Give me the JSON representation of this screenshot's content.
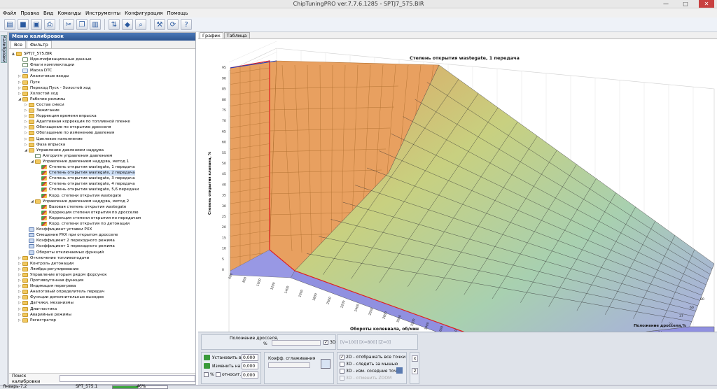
{
  "window": {
    "title": "ChipTuningPRO ver.7.7.6.1285 - SPTJ7_575.BIR",
    "minimize": "—",
    "maximize": "□",
    "close": "✕"
  },
  "menu": [
    "Файл",
    "Правка",
    "Вид",
    "Команды",
    "Инструменты",
    "Конфигурация",
    "Помощь"
  ],
  "sidetab": {
    "label": "Калибровки"
  },
  "leftpanel": {
    "header": "Меню калибровок",
    "tabs": [
      "Все",
      "Фильтр"
    ],
    "search_label": "Поиск калибровки",
    "search_value": ""
  },
  "tree": [
    {
      "label": "SPTJ7_575.BIR",
      "level": 0,
      "icon": "folder",
      "tw": "▲"
    },
    {
      "label": "Идентификационные данные",
      "level": 1,
      "icon": "check",
      "tw": ""
    },
    {
      "label": "Флаги комплектации",
      "level": 1,
      "icon": "check",
      "tw": ""
    },
    {
      "label": "Маска DTC",
      "level": 1,
      "icon": "doc",
      "tw": ""
    },
    {
      "label": "Аналоговые входы",
      "level": 1,
      "icon": "folder",
      "tw": "▷"
    },
    {
      "label": "Пуск",
      "level": 1,
      "icon": "folder",
      "tw": "▷"
    },
    {
      "label": "Переход Пуск - Холостой ход",
      "level": 1,
      "icon": "folder",
      "tw": "▷"
    },
    {
      "label": "Холостой ход",
      "level": 1,
      "icon": "folder",
      "tw": "▷"
    },
    {
      "label": "Рабочие режимы",
      "level": 1,
      "icon": "folder",
      "tw": "◢"
    },
    {
      "label": "Состав смеси",
      "level": 2,
      "icon": "folder",
      "tw": "▷"
    },
    {
      "label": "Зажигание",
      "level": 2,
      "icon": "folder",
      "tw": "▷"
    },
    {
      "label": "Коррекция времени впрыска",
      "level": 2,
      "icon": "folder",
      "tw": "▷"
    },
    {
      "label": "Адаптивная коррекция по топливной пленке",
      "level": 2,
      "icon": "folder",
      "tw": "▷"
    },
    {
      "label": "Обогащение по открытию дросселя",
      "level": 2,
      "icon": "folder",
      "tw": "▷"
    },
    {
      "label": "Обогащение по изменению давления",
      "level": 2,
      "icon": "folder",
      "tw": "▷"
    },
    {
      "label": "Цикловое наполнение",
      "level": 2,
      "icon": "folder",
      "tw": "▷"
    },
    {
      "label": "Фаза впрыска",
      "level": 2,
      "icon": "folder",
      "tw": "▷"
    },
    {
      "label": "Управление давлением наддува",
      "level": 2,
      "icon": "folder",
      "tw": "◢"
    },
    {
      "label": "Алгоритм управления давлением",
      "level": 3,
      "icon": "check",
      "tw": ""
    },
    {
      "label": "Управление давлением наддува, метод 1",
      "level": 3,
      "icon": "folder",
      "tw": "◢"
    },
    {
      "label": "Степень открытия wastegate, 1 передача",
      "level": 4,
      "icon": "chart",
      "tw": ""
    },
    {
      "label": "Степень открытия wastegate, 2 передача",
      "level": 4,
      "icon": "chart",
      "tw": ""
    },
    {
      "label": "Степень открытия wastegate, 3 передача",
      "level": 4,
      "icon": "chart",
      "tw": ""
    },
    {
      "label": "Степень открытия wastegate, 4 передача",
      "level": 4,
      "icon": "chart",
      "tw": ""
    },
    {
      "label": "Степень открытия wastegate, 5,6 передачи",
      "level": 4,
      "icon": "chart",
      "tw": ""
    },
    {
      "label": "Корр. степени открытия wastegate",
      "level": 4,
      "icon": "chart",
      "tw": ""
    },
    {
      "label": "Управление давлением наддува, метод 2",
      "level": 3,
      "icon": "folder",
      "tw": "◢"
    },
    {
      "label": "Базовая степень открытия wastegate",
      "level": 4,
      "icon": "chart",
      "tw": ""
    },
    {
      "label": "Коррекция степени открытия по дросселю",
      "level": 4,
      "icon": "chart",
      "tw": ""
    },
    {
      "label": "Коррекция степени открытия по передачам",
      "level": 4,
      "icon": "chart",
      "tw": ""
    },
    {
      "label": "Корр. степени открытия по детонации",
      "level": 4,
      "icon": "chart",
      "tw": ""
    },
    {
      "label": "Коэффициент уставки РХХ",
      "level": 2,
      "icon": "grid",
      "tw": ""
    },
    {
      "label": "Смещение РХХ при открытом дросселе",
      "level": 2,
      "icon": "grid",
      "tw": ""
    },
    {
      "label": "Коэффициент 2 переходного режима",
      "level": 2,
      "icon": "grid",
      "tw": ""
    },
    {
      "label": "Коэффициент 1 переходного режима",
      "level": 2,
      "icon": "grid",
      "tw": ""
    },
    {
      "label": "Обороты отключаемых функций",
      "level": 2,
      "icon": "grid",
      "tw": ""
    },
    {
      "label": "Отключение топливоподачи",
      "level": 1,
      "icon": "folder",
      "tw": "▷"
    },
    {
      "label": "Контроль детонации",
      "level": 1,
      "icon": "folder",
      "tw": "▷"
    },
    {
      "label": "Лямбда-регулирование",
      "level": 1,
      "icon": "folder",
      "tw": "▷"
    },
    {
      "label": "Управление вторым рядом форсунок",
      "level": 1,
      "icon": "folder",
      "tw": "▷"
    },
    {
      "label": "Противоугонная функция",
      "level": 1,
      "icon": "folder",
      "tw": "▷"
    },
    {
      "label": "Индикация перегрева",
      "level": 1,
      "icon": "folder",
      "tw": "▷"
    },
    {
      "label": "Аналоговый определитель передач",
      "level": 1,
      "icon": "folder",
      "tw": "▷"
    },
    {
      "label": "Функции дополнительных выходов",
      "level": 1,
      "icon": "folder",
      "tw": "▷"
    },
    {
      "label": "Датчики, механизмы",
      "level": 1,
      "icon": "folder",
      "tw": "▷"
    },
    {
      "label": "Диагностика",
      "level": 1,
      "icon": "folder",
      "tw": "▷"
    },
    {
      "label": "Аварийные режимы",
      "level": 1,
      "icon": "folder",
      "tw": "▷"
    },
    {
      "label": "Регистратор",
      "level": 1,
      "icon": "folder",
      "tw": "▷"
    }
  ],
  "right": {
    "tabs": [
      "График",
      "Таблица"
    ]
  },
  "plot": {
    "title": "Степень открытия wastegate, 1 передача",
    "zlabel": "Степень открытия клапана, %",
    "xlabel": "Обороты коленвала, об/мин",
    "ylabel": "Положение дросселя,%",
    "zticks": [
      "0",
      "5",
      "10",
      "15",
      "20",
      "25",
      "30",
      "35",
      "40",
      "45",
      "50",
      "55",
      "60",
      "65",
      "70",
      "75",
      "80",
      "85",
      "90",
      "95"
    ],
    "rpm_ticks": [
      "600",
      "800",
      "1000",
      "1200",
      "1400",
      "1600",
      "1800",
      "2000",
      "2200",
      "2400",
      "2600",
      "2800",
      "3000",
      "3200",
      "3400",
      "3600",
      "4000",
      "4400",
      "4800",
      "5200",
      "5600",
      "6000",
      "6400",
      "6800"
    ],
    "thr_ticks": [
      "0",
      "4",
      "8",
      "14",
      "22",
      "37",
      "60",
      "80"
    ],
    "colors": {
      "low": "#8c8ce0",
      "mid": "#a8d0b0",
      "high": "#e0a060",
      "wall": "#e8a060"
    }
  },
  "bottom": {
    "throttle_label": "Положение дросселя,",
    "throttle_unit": "%",
    "cb_3d": "3D",
    "coords": "[V=100] [X=800] [Z=0]",
    "set_to": "Установить в",
    "set_to_val": "0,000",
    "change_by": "Изменить на",
    "change_by_val": "0,000",
    "percent": "%",
    "relative": "относит.",
    "relative_val": "0,000",
    "smooth": "Коэфф. сглаживания",
    "opt1": "2D - отображать все точки",
    "opt2": "3D - следить за мышью",
    "opt3": "3D - изм. соседние точки",
    "opt4": "3D - отменить ZOOM",
    "xbtn": "x",
    "twobtn": "2"
  },
  "status": {
    "left": "Январь-7.2",
    "file": "SPT_575.1",
    "progress_text": "46%",
    "progress": 0.46
  }
}
